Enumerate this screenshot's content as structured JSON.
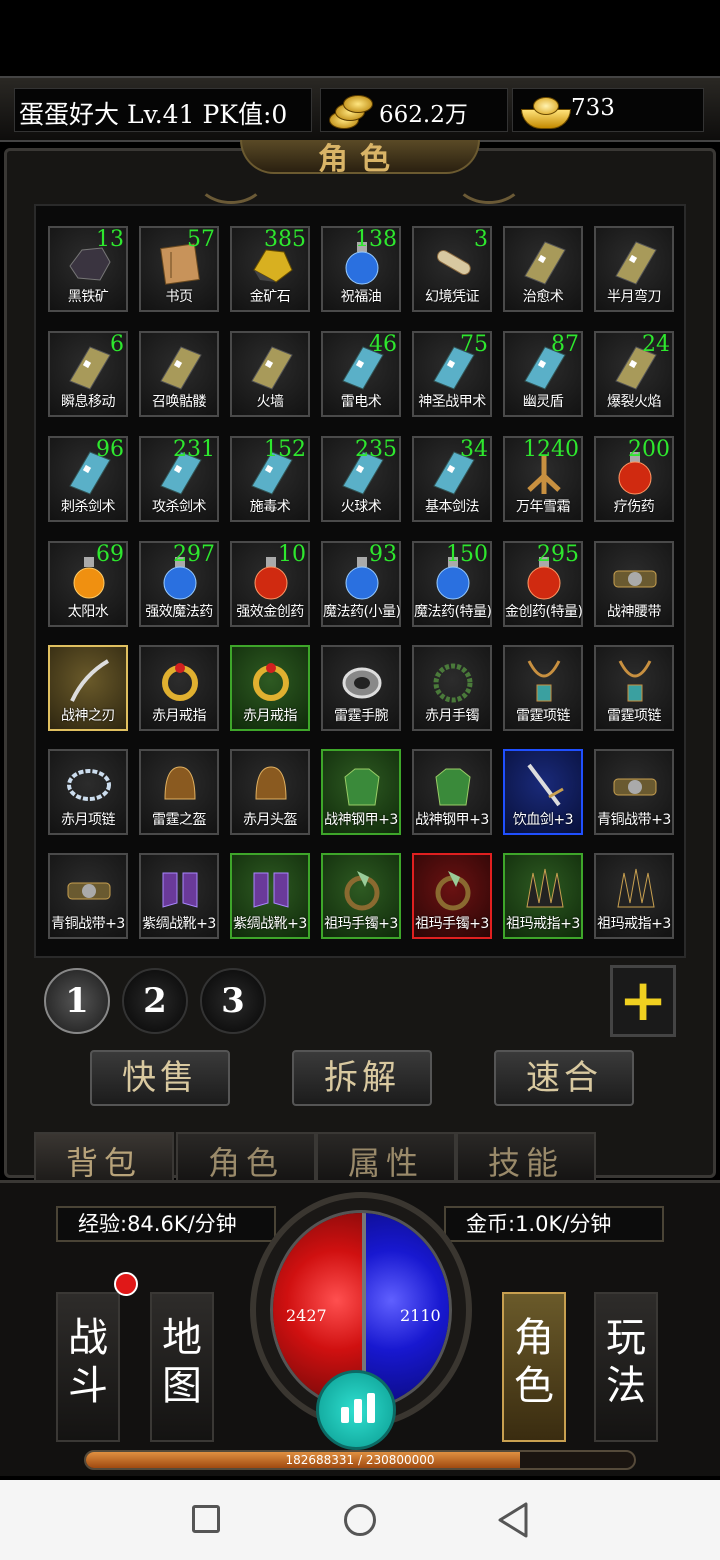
{
  "player": {
    "name": "蛋蛋好大",
    "level": "Lv.41",
    "pk": "PK值:0"
  },
  "currency": {
    "gold": "662.2万",
    "ingot": "733"
  },
  "panel_title": "角色",
  "inventory": [
    {
      "name": "黑铁矿",
      "count": "13",
      "icon": "ore-icon",
      "rarity": "normal"
    },
    {
      "name": "书页",
      "count": "57",
      "icon": "book-page-icon",
      "rarity": "normal"
    },
    {
      "name": "金矿石",
      "count": "385",
      "icon": "gold-ore-icon",
      "rarity": "normal"
    },
    {
      "name": "祝福油",
      "count": "138",
      "icon": "blue-potion-icon",
      "rarity": "normal"
    },
    {
      "name": "幻境凭证",
      "count": "3",
      "icon": "scroll-icon",
      "rarity": "normal"
    },
    {
      "name": "治愈术",
      "count": "",
      "icon": "skill-book-icon",
      "rarity": "normal"
    },
    {
      "name": "半月弯刀",
      "count": "",
      "icon": "skill-book-icon",
      "rarity": "normal"
    },
    {
      "name": "瞬息移动",
      "count": "6",
      "icon": "skill-book-icon",
      "rarity": "normal"
    },
    {
      "name": "召唤骷髅",
      "count": "",
      "icon": "skill-book-icon",
      "rarity": "normal"
    },
    {
      "name": "火墙",
      "count": "",
      "icon": "skill-book-icon",
      "rarity": "normal"
    },
    {
      "name": "雷电术",
      "count": "46",
      "icon": "blue-book-icon",
      "rarity": "normal"
    },
    {
      "name": "神圣战甲术",
      "count": "75",
      "icon": "blue-book-icon",
      "rarity": "normal"
    },
    {
      "name": "幽灵盾",
      "count": "87",
      "icon": "blue-book-icon",
      "rarity": "normal"
    },
    {
      "name": "爆裂火焰",
      "count": "24",
      "icon": "skill-book-icon",
      "rarity": "normal"
    },
    {
      "name": "刺杀剑术",
      "count": "96",
      "icon": "blue-book-icon",
      "rarity": "normal"
    },
    {
      "name": "攻杀剑术",
      "count": "231",
      "icon": "blue-book-icon",
      "rarity": "normal"
    },
    {
      "name": "施毒术",
      "count": "152",
      "icon": "blue-book-icon",
      "rarity": "normal"
    },
    {
      "name": "火球术",
      "count": "235",
      "icon": "blue-book-icon",
      "rarity": "normal"
    },
    {
      "name": "基本剑法",
      "count": "34",
      "icon": "blue-book-icon",
      "rarity": "normal"
    },
    {
      "name": "万年雪霜",
      "count": "1240",
      "icon": "ginseng-icon",
      "rarity": "normal"
    },
    {
      "name": "疗伤药",
      "count": "200",
      "icon": "red-potion-icon",
      "rarity": "normal"
    },
    {
      "name": "太阳水",
      "count": "69",
      "icon": "orange-potion-icon",
      "rarity": "normal"
    },
    {
      "name": "强效魔法药",
      "count": "297",
      "icon": "blue-potion-icon",
      "rarity": "normal"
    },
    {
      "name": "强效金创药",
      "count": "10",
      "icon": "red-potion-icon",
      "rarity": "normal"
    },
    {
      "name": "魔法药(小量)",
      "count": "93",
      "icon": "blue-potion-icon",
      "rarity": "normal"
    },
    {
      "name": "魔法药(特量)",
      "count": "150",
      "icon": "blue-potion-icon",
      "rarity": "normal"
    },
    {
      "name": "金创药(特量)",
      "count": "295",
      "icon": "red-potion-icon",
      "rarity": "normal"
    },
    {
      "name": "战神腰带",
      "count": "",
      "icon": "belt-icon",
      "rarity": "normal"
    },
    {
      "name": "战神之刃",
      "count": "",
      "icon": "blade-icon",
      "rarity": "legend"
    },
    {
      "name": "赤月戒指",
      "count": "",
      "icon": "ring-icon",
      "rarity": "normal"
    },
    {
      "name": "赤月戒指",
      "count": "",
      "icon": "ring-icon",
      "rarity": "green"
    },
    {
      "name": "雷霆手腕",
      "count": "",
      "icon": "bracelet-icon",
      "rarity": "normal"
    },
    {
      "name": "赤月手镯",
      "count": "",
      "icon": "bead-bracelet-icon",
      "rarity": "normal"
    },
    {
      "name": "雷霆项链",
      "count": "",
      "icon": "necklace-icon",
      "rarity": "normal"
    },
    {
      "name": "雷霆项链",
      "count": "",
      "icon": "necklace-icon",
      "rarity": "normal"
    },
    {
      "name": "赤月项链",
      "count": "",
      "icon": "chain-necklace-icon",
      "rarity": "normal"
    },
    {
      "name": "雷霆之盔",
      "count": "",
      "icon": "helmet-icon",
      "rarity": "normal"
    },
    {
      "name": "赤月头盔",
      "count": "",
      "icon": "helmet-icon",
      "rarity": "normal"
    },
    {
      "name": "战神钢甲+3",
      "count": "",
      "icon": "armor-icon",
      "rarity": "green"
    },
    {
      "name": "战神钢甲+3",
      "count": "",
      "icon": "armor-icon",
      "rarity": "normal"
    },
    {
      "name": "饮血剑+3",
      "count": "",
      "icon": "sword-icon",
      "rarity": "blue"
    },
    {
      "name": "青铜战带+3",
      "count": "",
      "icon": "belt-icon",
      "rarity": "normal"
    },
    {
      "name": "青铜战带+3",
      "count": "",
      "icon": "belt-icon",
      "rarity": "normal"
    },
    {
      "name": "紫绸战靴+3",
      "count": "",
      "icon": "boots-icon",
      "rarity": "normal"
    },
    {
      "name": "紫绸战靴+3",
      "count": "",
      "icon": "boots-icon",
      "rarity": "green"
    },
    {
      "name": "祖玛手镯+3",
      "count": "",
      "icon": "claw-bracelet-icon",
      "rarity": "green"
    },
    {
      "name": "祖玛手镯+3",
      "count": "",
      "icon": "claw-bracelet-icon",
      "rarity": "red"
    },
    {
      "name": "祖玛戒指+3",
      "count": "",
      "icon": "spike-ring-icon",
      "rarity": "green"
    },
    {
      "name": "祖玛戒指+3",
      "count": "",
      "icon": "spike-ring-icon",
      "rarity": "normal"
    }
  ],
  "pages": [
    "1",
    "2",
    "3"
  ],
  "plus_label": "+",
  "actions": {
    "quick_sell": "快售",
    "dismantle": "拆解",
    "fast_merge": "速合"
  },
  "tabs": [
    "背包",
    "角色",
    "属性",
    "技能"
  ],
  "hud": {
    "exp_rate": "经验:84.6K/分钟",
    "gold_rate": "金币:1.0K/分钟",
    "hp": "2427",
    "mp": "2110",
    "xp_text": "182688331 / 230800000",
    "xp_progress": 0.7915,
    "left_buttons": [
      "战斗",
      "地图"
    ],
    "right_buttons": [
      "角色",
      "玩法"
    ]
  },
  "colors": {
    "count_green": "#2ee82e",
    "rarity_green": "#3ea62a",
    "rarity_red": "#e02020",
    "rarity_blue": "#2050ff",
    "rarity_gold": "#e0c060"
  }
}
